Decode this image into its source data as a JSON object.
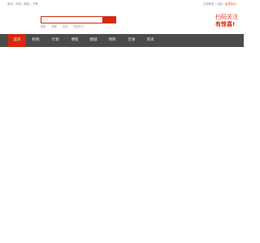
{
  "topbar": {
    "left_links": [
      "首页",
      "本站",
      "微信",
      "下载"
    ],
    "right_links": [
      "立即登录",
      "注册",
      "会员中心"
    ]
  },
  "search": {
    "placeholder": "",
    "button_label": ""
  },
  "hot_words": [
    "搜索",
    "课程",
    "活动",
    "在线学习"
  ],
  "promo": {
    "line1": "扫码关注",
    "line2": "有惊喜!"
  },
  "nav": {
    "items": [
      {
        "label": "首页",
        "active": true
      },
      {
        "label": "机构"
      },
      {
        "label": "计划"
      },
      {
        "label": "课程"
      },
      {
        "label": "图城"
      },
      {
        "label": "项目"
      },
      {
        "label": "饮食"
      },
      {
        "label": "资讯"
      }
    ]
  },
  "colors": {
    "accent": "#d6290e",
    "nav_bg": "#4b4b4b"
  }
}
